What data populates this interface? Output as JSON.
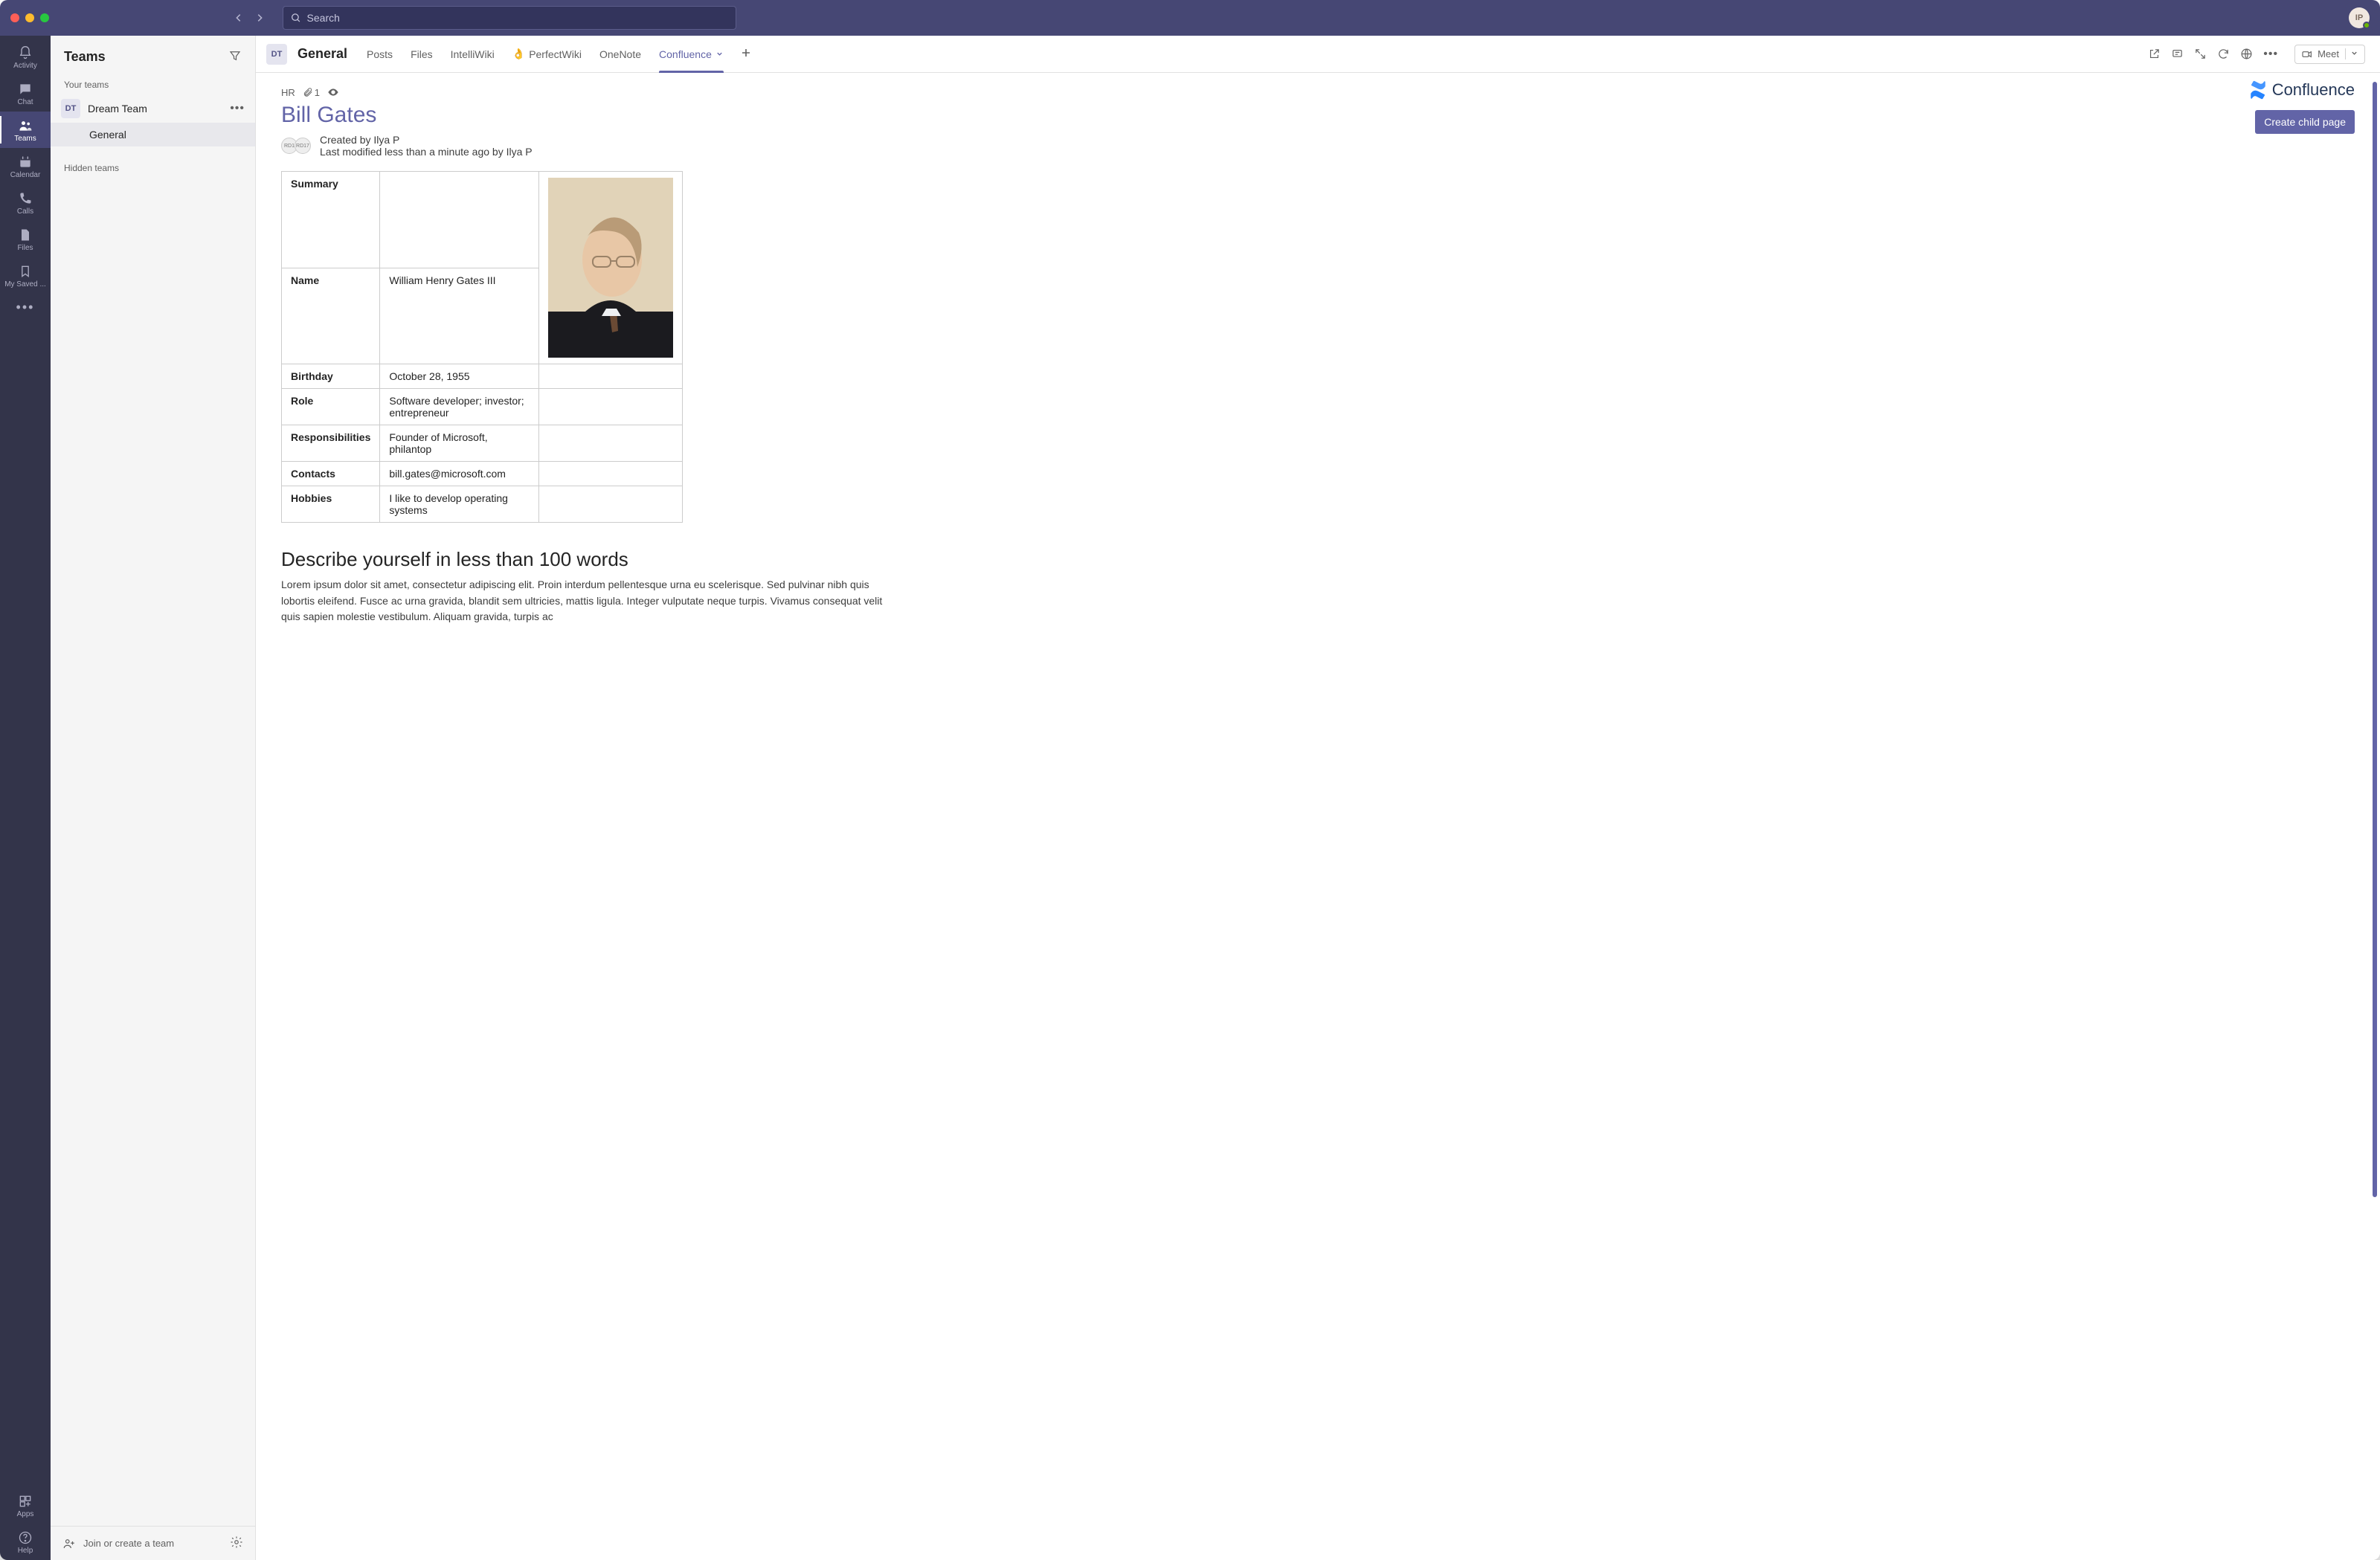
{
  "titlebar": {
    "search_placeholder": "Search",
    "avatar_initials": "IP"
  },
  "rail": {
    "items": [
      {
        "id": "activity",
        "label": "Activity"
      },
      {
        "id": "chat",
        "label": "Chat"
      },
      {
        "id": "teams",
        "label": "Teams"
      },
      {
        "id": "calendar",
        "label": "Calendar"
      },
      {
        "id": "calls",
        "label": "Calls"
      },
      {
        "id": "files",
        "label": "Files"
      },
      {
        "id": "mysaved",
        "label": "My Saved ..."
      }
    ],
    "apps_label": "Apps",
    "help_label": "Help"
  },
  "teams_panel": {
    "title": "Teams",
    "your_teams_label": "Your teams",
    "team_initials": "DT",
    "team_name": "Dream Team",
    "channel_name": "General",
    "hidden_label": "Hidden teams",
    "footer_label": "Join or create a team"
  },
  "tabs_bar": {
    "channel_chip": "DT",
    "channel_title": "General",
    "tabs": [
      {
        "label": "Posts"
      },
      {
        "label": "Files"
      },
      {
        "label": "IntelliWiki"
      },
      {
        "label": "PerfectWiki",
        "emoji": "👌"
      },
      {
        "label": "OneNote"
      },
      {
        "label": "Confluence",
        "active": true,
        "chevron": true
      }
    ],
    "meet_label": "Meet"
  },
  "page": {
    "breadcrumb": "HR",
    "attachment_count": "1",
    "confluence_label": "Confluence",
    "create_child_btn": "Create child page",
    "title": "Bill Gates",
    "created_by": "Created by Ilya P",
    "modified_by": "Last modified less than a minute ago by Ilya P",
    "summary_label": "Summary",
    "rows": [
      {
        "label": "Name",
        "value": "William Henry Gates III"
      },
      {
        "label": "Birthday",
        "value": "October 28, 1955"
      },
      {
        "label": "Role",
        "value": "Software developer; investor; entrepreneur"
      },
      {
        "label": "Responsibilities",
        "value": "Founder of Microsoft, philantop"
      },
      {
        "label": "Contacts",
        "value": "bill.gates@microsoft.com"
      },
      {
        "label": "Hobbies",
        "value": "I like to develop operating systems"
      }
    ],
    "section_heading": "Describe yourself in less than 100 words",
    "lorem": "Lorem ipsum dolor sit amet, consectetur adipiscing elit. Proin interdum pellentesque urna eu scelerisque. Sed pulvinar nibh quis lobortis eleifend. Fusce ac urna gravida, blandit sem ultricies, mattis ligula. Integer vulputate neque turpis. Vivamus consequat velit quis sapien molestie vestibulum. Aliquam gravida, turpis ac"
  }
}
